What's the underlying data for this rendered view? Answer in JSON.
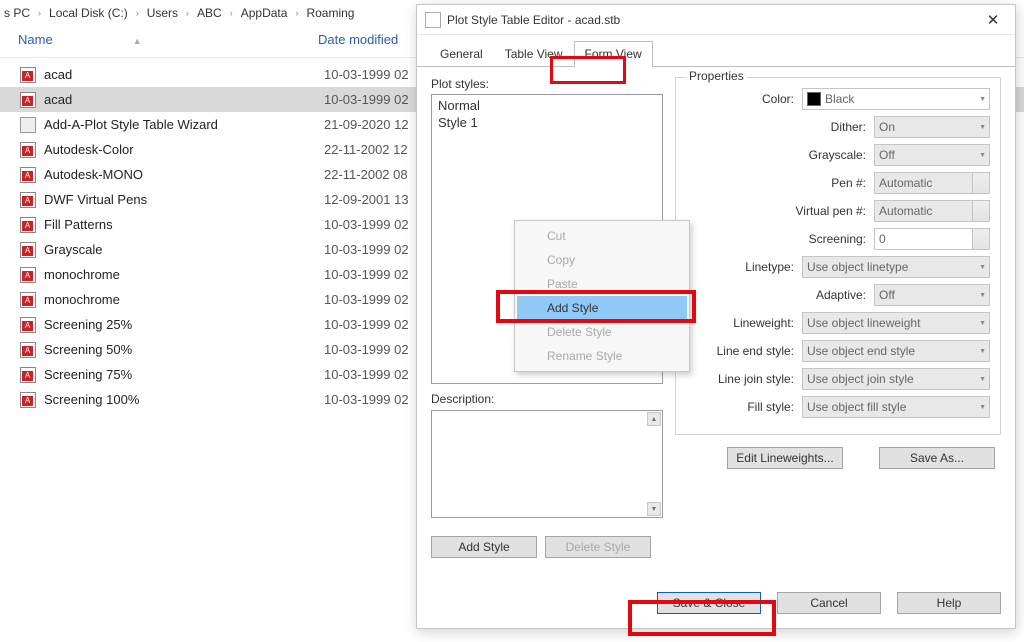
{
  "breadcrumb": [
    "s PC",
    "Local Disk (C:)",
    "Users",
    "ABC",
    "AppData",
    "Roaming"
  ],
  "cols": {
    "name": "Name",
    "date": "Date modified"
  },
  "files": [
    {
      "name": "acad",
      "date": "10-03-1999 02",
      "wiz": false,
      "sel": false
    },
    {
      "name": "acad",
      "date": "10-03-1999 02",
      "wiz": false,
      "sel": true
    },
    {
      "name": "Add-A-Plot Style Table Wizard",
      "date": "21-09-2020 12",
      "wiz": true,
      "sel": false
    },
    {
      "name": "Autodesk-Color",
      "date": "22-11-2002 12",
      "wiz": false,
      "sel": false
    },
    {
      "name": "Autodesk-MONO",
      "date": "22-11-2002 08",
      "wiz": false,
      "sel": false
    },
    {
      "name": "DWF Virtual Pens",
      "date": "12-09-2001 13",
      "wiz": false,
      "sel": false
    },
    {
      "name": "Fill Patterns",
      "date": "10-03-1999 02",
      "wiz": false,
      "sel": false
    },
    {
      "name": "Grayscale",
      "date": "10-03-1999 02",
      "wiz": false,
      "sel": false
    },
    {
      "name": "monochrome",
      "date": "10-03-1999 02",
      "wiz": false,
      "sel": false
    },
    {
      "name": "monochrome",
      "date": "10-03-1999 02",
      "wiz": false,
      "sel": false
    },
    {
      "name": "Screening 25%",
      "date": "10-03-1999 02",
      "wiz": false,
      "sel": false
    },
    {
      "name": "Screening 50%",
      "date": "10-03-1999 02",
      "wiz": false,
      "sel": false
    },
    {
      "name": "Screening 75%",
      "date": "10-03-1999 02",
      "wiz": false,
      "sel": false
    },
    {
      "name": "Screening 100%",
      "date": "10-03-1999 02",
      "wiz": false,
      "sel": false
    }
  ],
  "dialog": {
    "title": "Plot Style Table Editor - acad.stb",
    "tabs": {
      "general": "General",
      "tableView": "Table View",
      "formView": "Form View"
    },
    "plotStylesLabel": "Plot styles:",
    "plotStyles": [
      "Normal",
      "Style 1"
    ],
    "descriptionLabel": "Description:",
    "addStyleBtn": "Add Style",
    "deleteStyleBtn": "Delete Style",
    "props": {
      "legend": "Properties",
      "color": {
        "label": "Color:",
        "value": "Black"
      },
      "dither": {
        "label": "Dither:",
        "value": "On"
      },
      "grayscale": {
        "label": "Grayscale:",
        "value": "Off"
      },
      "pen": {
        "label": "Pen #:",
        "value": "Automatic"
      },
      "vpen": {
        "label": "Virtual pen #:",
        "value": "Automatic"
      },
      "screening": {
        "label": "Screening:",
        "value": "0"
      },
      "linetype": {
        "label": "Linetype:",
        "value": "Use object linetype"
      },
      "adaptive": {
        "label": "Adaptive:",
        "value": "Off"
      },
      "lineweight": {
        "label": "Lineweight:",
        "value": "Use object lineweight"
      },
      "lineend": {
        "label": "Line end style:",
        "value": "Use object end style"
      },
      "linejoin": {
        "label": "Line join style:",
        "value": "Use object join style"
      },
      "fill": {
        "label": "Fill style:",
        "value": "Use object fill style"
      },
      "editLineweights": "Edit Lineweights...",
      "saveAs": "Save As..."
    },
    "footer": {
      "saveClose": "Save & Close",
      "cancel": "Cancel",
      "help": "Help"
    }
  },
  "ctx": {
    "cut": "Cut",
    "copy": "Copy",
    "paste": "Paste",
    "add": "Add Style",
    "delete": "Delete Style",
    "rename": "Rename Style"
  }
}
